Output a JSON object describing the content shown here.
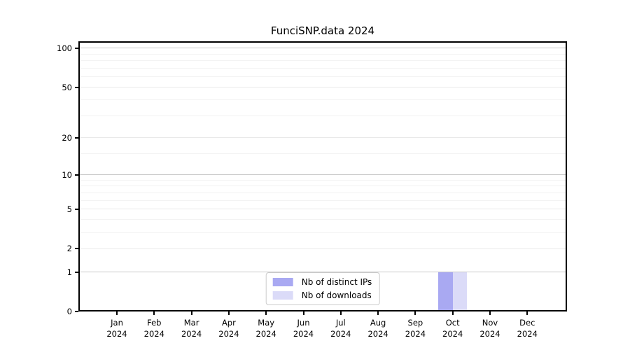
{
  "chart_data": {
    "type": "bar",
    "title": "FunciSNP.data 2024",
    "categories": [
      "Jan",
      "Feb",
      "Mar",
      "Apr",
      "May",
      "Jun",
      "Jul",
      "Aug",
      "Sep",
      "Oct",
      "Nov",
      "Dec"
    ],
    "year_label": "2024",
    "series": [
      {
        "name": "Nb of distinct IPs",
        "color": "#a9a9f2",
        "values": [
          0,
          0,
          0,
          0,
          0,
          0,
          0,
          0,
          0,
          1,
          0,
          0
        ]
      },
      {
        "name": "Nb of downloads",
        "color": "#dbdbf8",
        "values": [
          0,
          0,
          0,
          0,
          0,
          0,
          0,
          0,
          0,
          1,
          0,
          0
        ]
      }
    ],
    "yscale": "log1p",
    "ylim": [
      0,
      113
    ],
    "yticks": [
      0,
      1,
      2,
      5,
      10,
      20,
      50,
      100
    ],
    "decade_gridlines": [
      1,
      10,
      100
    ],
    "mid_gridlines": [
      2,
      5,
      20,
      50
    ],
    "minor_gridlines": [
      3,
      4,
      6,
      7,
      8,
      9,
      15,
      30,
      40,
      60,
      70,
      80,
      90
    ],
    "grid": true,
    "legend_position": "bottom-center",
    "colors": {
      "axis": "#000000",
      "grid_decade": "#c8c8c8",
      "grid_mid": "#e9e9e9",
      "grid_minor": "#f3f3f3",
      "legend_border": "#cccccc",
      "background": "#ffffff"
    }
  }
}
